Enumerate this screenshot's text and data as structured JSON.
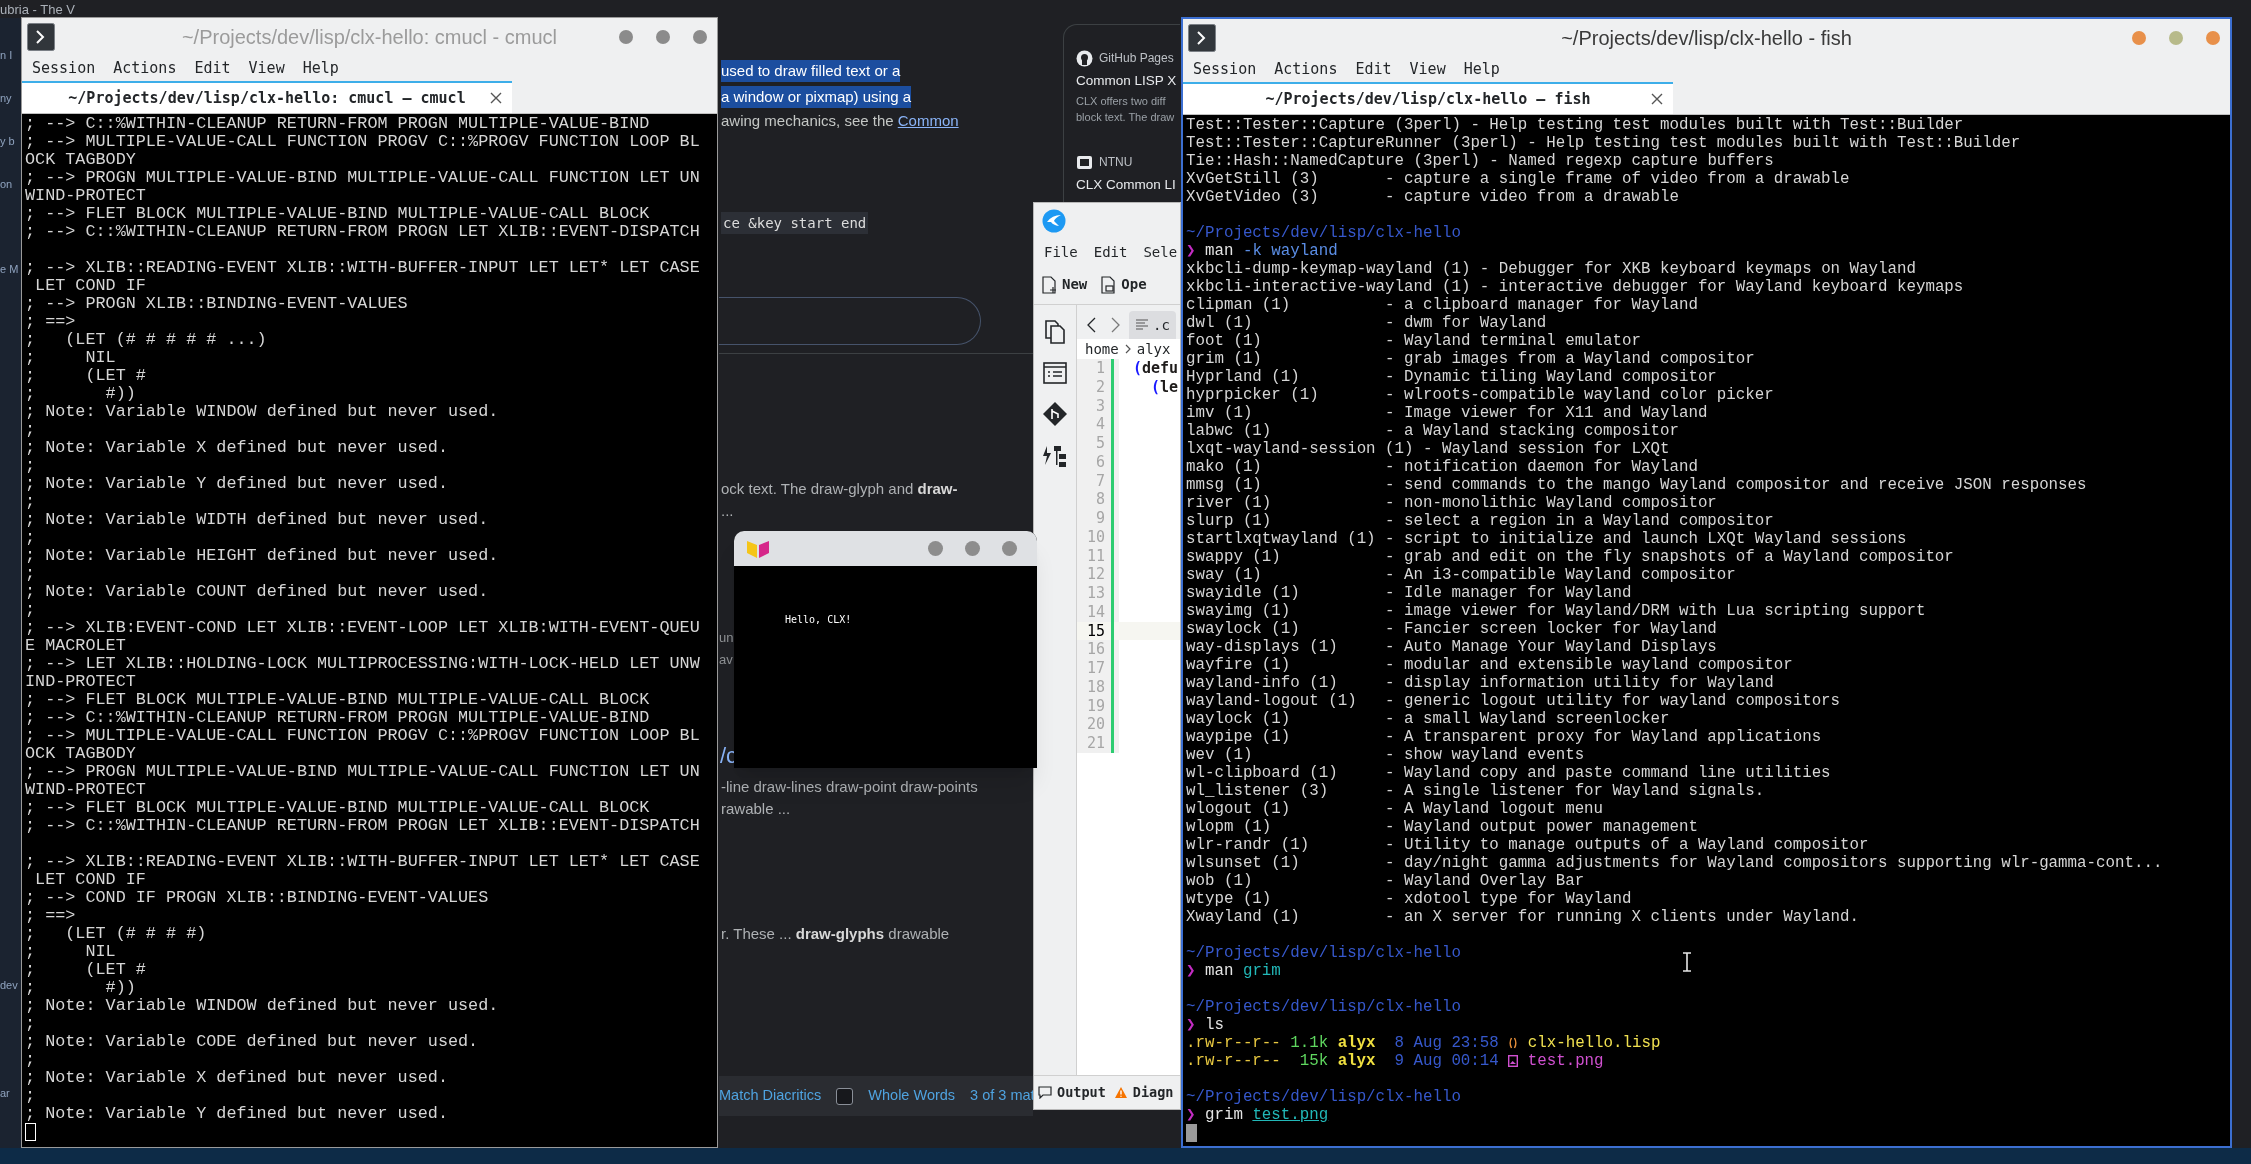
{
  "browser": {
    "tab_fragment": "ubria - The V",
    "sidebar_fragments": [
      "n I",
      "ny",
      "y b",
      "on",
      "e M",
      "dev",
      "ar"
    ],
    "article": [
      {
        "kind": "highlight",
        "text": "used to draw filled text or a"
      },
      {
        "kind": "highlight",
        "text": "a window or pixmap) using a"
      },
      {
        "kind": "link_text",
        "text": "awing mechanics, see the ",
        "link": "Common"
      },
      {
        "kind": "code",
        "text": "ce &key start end"
      },
      {
        "kind": "rich",
        "text": "ock text. The draw-glyph and **draw-**"
      },
      {
        "kind": "text",
        "text": "..."
      },
      {
        "kind": "fragment",
        "text": "un"
      },
      {
        "kind": "fragment",
        "text": "av"
      },
      {
        "kind": "heading_link",
        "text": "/c"
      },
      {
        "kind": "text",
        "text": "-line draw-lines draw-point draw-points"
      },
      {
        "kind": "text",
        "text": "rawable ..."
      },
      {
        "kind": "rich",
        "text": "r. These ... **draw-glyphs** drawable"
      }
    ],
    "results": [
      {
        "source": "GitHub Pages",
        "title": "Common LISP X",
        "snippet": [
          "CLX offers two diff",
          "block text. The draw"
        ]
      },
      {
        "source": "NTNU",
        "title": "CLX Common LI"
      }
    ],
    "find_bar": {
      "match_diacritics": "Match Diacritics",
      "whole_words": {
        "label": "Whole Words",
        "checked": false
      },
      "match_count": "3 of 3 mat"
    }
  },
  "windows": [
    {
      "kind": "terminal",
      "title": "~/Projects/dev/lisp/clx-hello: cmucl - cmucl",
      "active": false,
      "menu": [
        "Session",
        "Actions",
        "Edit",
        "View",
        "Help"
      ],
      "tab": {
        "label": "~/Projects/dev/lisp/clx-hello: cmucl – cmucl",
        "selected": true
      },
      "lines": [
        {
          "kind": "out",
          "text": "; --> C::%WITHIN-CLEANUP RETURN-FROM PROGN MULTIPLE-VALUE-BIND"
        },
        {
          "kind": "out",
          "text": "; --> MULTIPLE-VALUE-CALL FUNCTION PROGV C::%PROGV FUNCTION LOOP BL"
        },
        {
          "kind": "out",
          "text": "OCK TAGBODY"
        },
        {
          "kind": "out",
          "text": "; --> PROGN MULTIPLE-VALUE-BIND MULTIPLE-VALUE-CALL FUNCTION LET UN"
        },
        {
          "kind": "out",
          "text": "WIND-PROTECT"
        },
        {
          "kind": "out",
          "text": "; --> FLET BLOCK MULTIPLE-VALUE-BIND MULTIPLE-VALUE-CALL BLOCK"
        },
        {
          "kind": "out",
          "text": "; --> C::%WITHIN-CLEANUP RETURN-FROM PROGN LET XLIB::EVENT-DISPATCH"
        },
        {
          "kind": "blank"
        },
        {
          "kind": "out",
          "text": "; --> XLIB::READING-EVENT XLIB::WITH-BUFFER-INPUT LET LET* LET CASE"
        },
        {
          "kind": "out",
          "text": " LET COND IF"
        },
        {
          "kind": "out",
          "text": "; --> PROGN XLIB::BINDING-EVENT-VALUES"
        },
        {
          "kind": "out",
          "text": "; ==>"
        },
        {
          "kind": "out",
          "text": ";   (LET (# # # # # ...)"
        },
        {
          "kind": "out",
          "text": ";     NIL"
        },
        {
          "kind": "out",
          "text": ";     (LET #"
        },
        {
          "kind": "out",
          "text": ";       #))"
        },
        {
          "kind": "out",
          "text": "; Note: Variable WINDOW defined but never used."
        },
        {
          "kind": "out",
          "text": ";"
        },
        {
          "kind": "out",
          "text": "; Note: Variable X defined but never used."
        },
        {
          "kind": "out",
          "text": ";"
        },
        {
          "kind": "out",
          "text": "; Note: Variable Y defined but never used."
        },
        {
          "kind": "out",
          "text": ";"
        },
        {
          "kind": "out",
          "text": "; Note: Variable WIDTH defined but never used."
        },
        {
          "kind": "out",
          "text": ";"
        },
        {
          "kind": "out",
          "text": "; Note: Variable HEIGHT defined but never used."
        },
        {
          "kind": "out",
          "text": ";"
        },
        {
          "kind": "out",
          "text": "; Note: Variable COUNT defined but never used."
        },
        {
          "kind": "out",
          "text": ";"
        },
        {
          "kind": "out",
          "text": "; --> XLIB:EVENT-COND LET XLIB::EVENT-LOOP LET XLIB:WITH-EVENT-QUEU"
        },
        {
          "kind": "out",
          "text": "E MACROLET"
        },
        {
          "kind": "out",
          "text": "; --> LET XLIB::HOLDING-LOCK MULTIPROCESSING:WITH-LOCK-HELD LET UNW"
        },
        {
          "kind": "out",
          "text": "IND-PROTECT"
        },
        {
          "kind": "out",
          "text": "; --> FLET BLOCK MULTIPLE-VALUE-BIND MULTIPLE-VALUE-CALL BLOCK"
        },
        {
          "kind": "out",
          "text": "; --> C::%WITHIN-CLEANUP RETURN-FROM PROGN MULTIPLE-VALUE-BIND"
        },
        {
          "kind": "out",
          "text": "; --> MULTIPLE-VALUE-CALL FUNCTION PROGV C::%PROGV FUNCTION LOOP BL"
        },
        {
          "kind": "out",
          "text": "OCK TAGBODY"
        },
        {
          "kind": "out",
          "text": "; --> PROGN MULTIPLE-VALUE-BIND MULTIPLE-VALUE-CALL FUNCTION LET UN"
        },
        {
          "kind": "out",
          "text": "WIND-PROTECT"
        },
        {
          "kind": "out",
          "text": "; --> FLET BLOCK MULTIPLE-VALUE-BIND MULTIPLE-VALUE-CALL BLOCK"
        },
        {
          "kind": "out",
          "text": "; --> C::%WITHIN-CLEANUP RETURN-FROM PROGN LET XLIB::EVENT-DISPATCH"
        },
        {
          "kind": "blank"
        },
        {
          "kind": "out",
          "text": "; --> XLIB::READING-EVENT XLIB::WITH-BUFFER-INPUT LET LET* LET CASE"
        },
        {
          "kind": "out",
          "text": " LET COND IF"
        },
        {
          "kind": "out",
          "text": "; --> COND IF PROGN XLIB::BINDING-EVENT-VALUES"
        },
        {
          "kind": "out",
          "text": "; ==>"
        },
        {
          "kind": "out",
          "text": ";   (LET (# # # #)"
        },
        {
          "kind": "out",
          "text": ";     NIL"
        },
        {
          "kind": "out",
          "text": ";     (LET #"
        },
        {
          "kind": "out",
          "text": ";       #))"
        },
        {
          "kind": "out",
          "text": "; Note: Variable WINDOW defined but never used."
        },
        {
          "kind": "out",
          "text": ";"
        },
        {
          "kind": "out",
          "text": "; Note: Variable CODE defined but never used."
        },
        {
          "kind": "out",
          "text": ";"
        },
        {
          "kind": "out",
          "text": "; Note: Variable X defined but never used."
        },
        {
          "kind": "out",
          "text": ";"
        },
        {
          "kind": "out",
          "text": "; Note: Variable Y defined but never used."
        },
        {
          "kind": "cursor"
        }
      ]
    },
    {
      "kind": "clx_window",
      "text": "Hello, CLX!"
    },
    {
      "kind": "editor",
      "menu": [
        "File",
        "Edit",
        "Sele"
      ],
      "toolbar": [
        {
          "kind": "new",
          "label": "New"
        },
        {
          "kind": "open",
          "label": "Ope"
        }
      ],
      "tab": {
        "label": ".c",
        "selected": true
      },
      "breadcrumb": [
        "home",
        "alyx"
      ],
      "lines": [
        {
          "number": "1",
          "current": false,
          "paren": "(",
          "code": "defu",
          "nested": false
        },
        {
          "number": "2",
          "current": false,
          "paren": "(",
          "code": "le",
          "nested": true
        },
        {
          "number": "3",
          "current": false
        },
        {
          "number": "4",
          "current": false
        },
        {
          "number": "5",
          "current": false
        },
        {
          "number": "6",
          "current": false
        },
        {
          "number": "7",
          "current": false
        },
        {
          "number": "8",
          "current": false
        },
        {
          "number": "9",
          "current": false
        },
        {
          "number": "10",
          "current": false
        },
        {
          "number": "11",
          "current": false
        },
        {
          "number": "12",
          "current": false
        },
        {
          "number": "13",
          "current": false
        },
        {
          "number": "14",
          "current": false
        },
        {
          "number": "15",
          "current": true
        },
        {
          "number": "16",
          "current": false
        },
        {
          "number": "17",
          "current": false
        },
        {
          "number": "18",
          "current": false
        },
        {
          "number": "19",
          "current": false
        },
        {
          "number": "20",
          "current": false
        },
        {
          "number": "21",
          "current": false
        }
      ],
      "panels": [
        {
          "kind": "output",
          "label": "Output"
        },
        {
          "kind": "diagnostics",
          "label": "Diagn"
        }
      ]
    },
    {
      "kind": "terminal",
      "title": "~/Projects/dev/lisp/clx-hello - fish",
      "active": true,
      "menu": [
        "Session",
        "Actions",
        "Edit",
        "View",
        "Help"
      ],
      "tab": {
        "label": "~/Projects/dev/lisp/clx-hello – fish",
        "selected": true
      },
      "lines": [
        {
          "kind": "man",
          "name": "Test::Tester::Capture (3perl)",
          "summary": "- Help testing test modules built with Test::Builder"
        },
        {
          "kind": "man",
          "name": "Test::Tester::CaptureRunner (3perl)",
          "summary": "- Help testing test modules built with Test::Builder"
        },
        {
          "kind": "man",
          "name": "Tie::Hash::NamedCapture (3perl)",
          "summary": "- Named regexp capture buffers"
        },
        {
          "kind": "man",
          "name": "XvGetStill (3)",
          "summary": "- capture a single frame of video from a drawable"
        },
        {
          "kind": "man",
          "name": "XvGetVideo (3)",
          "summary": "- capture video from a drawable"
        },
        {
          "kind": "blank"
        },
        {
          "kind": "path",
          "text": "~/Projects/dev/lisp/clx-hello"
        },
        {
          "kind": "command",
          "prompt": "❯",
          "parts": [
            {
              "text": "man",
              "kind": "command"
            },
            {
              "text": "-k wayland",
              "kind": "param"
            }
          ]
        },
        {
          "kind": "man",
          "name": "xkbcli-dump-keymap-wayland (1)",
          "summary": "- Debugger for XKB keyboard keymaps on Wayland"
        },
        {
          "kind": "man",
          "name": "xkbcli-interactive-wayland (1)",
          "summary": "- interactive debugger for Wayland keyboard keymaps"
        },
        {
          "kind": "man",
          "name": "clipman (1)",
          "summary": "- a clipboard manager for Wayland"
        },
        {
          "kind": "man",
          "name": "dwl (1)",
          "summary": "- dwm for Wayland"
        },
        {
          "kind": "man",
          "name": "foot (1)",
          "summary": "- Wayland terminal emulator"
        },
        {
          "kind": "man",
          "name": "grim (1)",
          "summary": "- grab images from a Wayland compositor"
        },
        {
          "kind": "man",
          "name": "Hyprland (1)",
          "summary": "- Dynamic tiling Wayland compositor"
        },
        {
          "kind": "man",
          "name": "hyprpicker (1)",
          "summary": "- wlroots-compatible wayland color picker"
        },
        {
          "kind": "man",
          "name": "imv (1)",
          "summary": "- Image viewer for X11 and Wayland"
        },
        {
          "kind": "man",
          "name": "labwc (1)",
          "summary": "- a Wayland stacking compositor"
        },
        {
          "kind": "man",
          "name": "lxqt-wayland-session (1)",
          "summary": "- Wayland session for LXQt"
        },
        {
          "kind": "man",
          "name": "mako (1)",
          "summary": "- notification daemon for Wayland"
        },
        {
          "kind": "man",
          "name": "mmsg (1)",
          "summary": "- send commands to the mango Wayland compositor and receive JSON responses"
        },
        {
          "kind": "man",
          "name": "river (1)",
          "summary": "- non-monolithic Wayland compositor"
        },
        {
          "kind": "man",
          "name": "slurp (1)",
          "summary": "- select a region in a Wayland compositor"
        },
        {
          "kind": "man",
          "name": "startlxqtwayland (1)",
          "summary": "- script to initialize and launch LXQt Wayland sessions"
        },
        {
          "kind": "man",
          "name": "swappy (1)",
          "summary": "- grab and edit on the fly snapshots of a Wayland compositor"
        },
        {
          "kind": "man",
          "name": "sway (1)",
          "summary": "- An i3-compatible Wayland compositor"
        },
        {
          "kind": "man",
          "name": "swayidle (1)",
          "summary": "- Idle manager for Wayland"
        },
        {
          "kind": "man",
          "name": "swayimg (1)",
          "summary": "- image viewer for Wayland/DRM with Lua scripting support"
        },
        {
          "kind": "man",
          "name": "swaylock (1)",
          "summary": "- Fancier screen locker for Wayland"
        },
        {
          "kind": "man",
          "name": "way-displays (1)",
          "summary": "- Auto Manage Your Wayland Displays"
        },
        {
          "kind": "man",
          "name": "wayfire (1)",
          "summary": "- modular and extensible wayland compositor"
        },
        {
          "kind": "man",
          "name": "wayland-info (1)",
          "summary": "- display information utility for Wayland"
        },
        {
          "kind": "man",
          "name": "wayland-logout (1)",
          "summary": "- generic logout utility for wayland compositors"
        },
        {
          "kind": "man",
          "name": "waylock (1)",
          "summary": "- a small Wayland screenlocker"
        },
        {
          "kind": "man",
          "name": "waypipe (1)",
          "summary": "- A transparent proxy for Wayland applications"
        },
        {
          "kind": "man",
          "name": "wev (1)",
          "summary": "- show wayland events"
        },
        {
          "kind": "man",
          "name": "wl-clipboard (1)",
          "summary": "- Wayland copy and paste command line utilities"
        },
        {
          "kind": "man",
          "name": "wl_listener (3)",
          "summary": "- A single listener for Wayland signals."
        },
        {
          "kind": "man",
          "name": "wlogout (1)",
          "summary": "- A Wayland logout menu"
        },
        {
          "kind": "man",
          "name": "wlopm (1)",
          "summary": "- Wayland output power management"
        },
        {
          "kind": "man",
          "name": "wlr-randr (1)",
          "summary": "- Utility to manage outputs of a Wayland compositor"
        },
        {
          "kind": "man",
          "name": "wlsunset (1)",
          "summary": "- day/night gamma adjustments for Wayland compositors supporting wlr-gamma-cont..."
        },
        {
          "kind": "man",
          "name": "wob (1)",
          "summary": "- Wayland Overlay Bar"
        },
        {
          "kind": "man",
          "name": "wtype (1)",
          "summary": "- xdotool type for Wayland"
        },
        {
          "kind": "man",
          "name": "Xwayland (1)",
          "summary": "- an X server for running X clients under Wayland."
        },
        {
          "kind": "blank"
        },
        {
          "kind": "path",
          "text": "~/Projects/dev/lisp/clx-hello"
        },
        {
          "kind": "command",
          "prompt": "❯",
          "parts": [
            {
              "text": "man",
              "kind": "command"
            },
            {
              "text": "grim",
              "kind": "argument"
            }
          ]
        },
        {
          "kind": "blank"
        },
        {
          "kind": "path",
          "text": "~/Projects/dev/lisp/clx-hello"
        },
        {
          "kind": "command",
          "prompt": "❯",
          "parts": [
            {
              "text": "ls",
              "kind": "command"
            }
          ]
        },
        {
          "kind": "ls_source",
          "perms": ".rw-r--r--",
          "size": "1.1k",
          "owner": "alyx",
          "date": "8 Aug 23:58",
          "name": "clx-hello.lisp"
        },
        {
          "kind": "ls_image",
          "perms": ".rw-r--r--",
          "size": "15k",
          "owner": "alyx",
          "date": "9 Aug 00:14",
          "name": "test.png"
        },
        {
          "kind": "blank"
        },
        {
          "kind": "path",
          "text": "~/Projects/dev/lisp/clx-hello"
        },
        {
          "kind": "command",
          "prompt": "❯",
          "parts": [
            {
              "text": "grim",
              "kind": "command"
            },
            {
              "text": "test.png",
              "kind": "path"
            }
          ]
        },
        {
          "kind": "cursor"
        }
      ]
    }
  ]
}
